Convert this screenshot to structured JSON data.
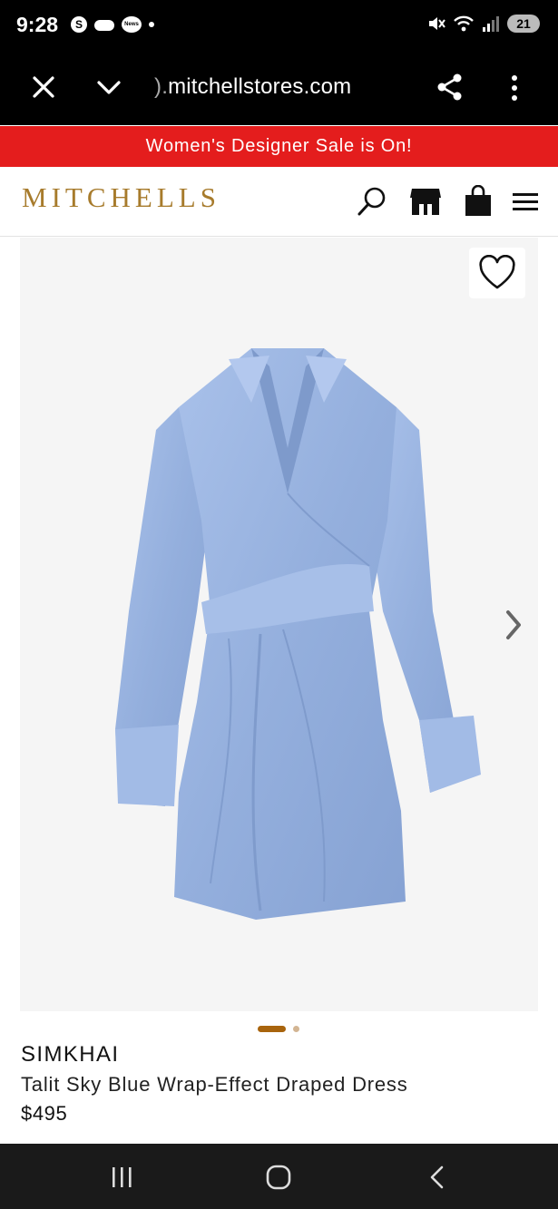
{
  "status_bar": {
    "time": "9:28",
    "notif_s_label": "S",
    "notif_news_label": "News",
    "battery": "21"
  },
  "browser": {
    "url": "mitchellstores.com",
    "url_prefix_clipped": ")."
  },
  "promo": {
    "text": "Women's Designer Sale is On!"
  },
  "header": {
    "logo": "MITCHELLS"
  },
  "product": {
    "brand": "SIMKHAI",
    "name": "Talit Sky Blue Wrap-Effect Draped Dress",
    "price": "$495",
    "image_count": 2,
    "active_image": 1
  },
  "colors": {
    "promo_red": "#e41d1d",
    "logo_gold": "#a77b2c",
    "dot_active": "#a8640d",
    "dot_inactive": "#d3b593",
    "dress_blue": "#9bb4e0"
  },
  "icons": [
    "close-icon",
    "chevron-down-icon",
    "share-icon",
    "more-vert-icon",
    "search-icon",
    "store-icon",
    "shopping-bag-icon",
    "hamburger-menu-icon",
    "heart-icon",
    "chevron-right-icon"
  ]
}
